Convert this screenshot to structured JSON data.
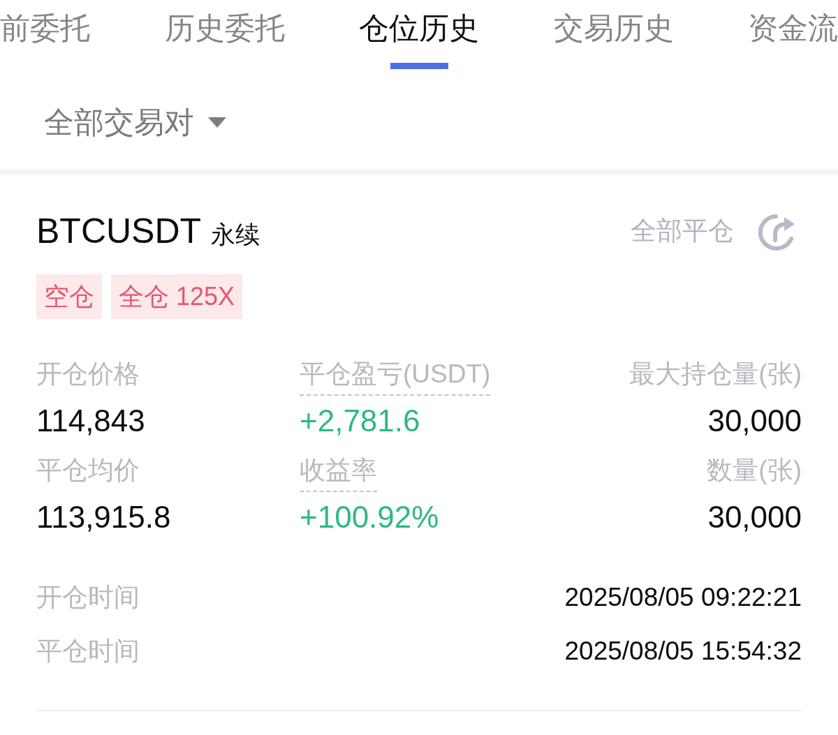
{
  "tabs": [
    {
      "label": "前委托",
      "selected": false
    },
    {
      "label": "历史委托",
      "selected": false
    },
    {
      "label": "仓位历史",
      "selected": true
    },
    {
      "label": "交易历史",
      "selected": false
    },
    {
      "label": "资金流",
      "selected": false
    }
  ],
  "filter": {
    "label": "全部交易对"
  },
  "position": {
    "symbol": "BTCUSDT",
    "contract_type": "永续",
    "close_all": "全部平仓",
    "tags": [
      {
        "label": "空仓"
      },
      {
        "label": "全仓 125X"
      }
    ],
    "stats": [
      {
        "label": "开仓价格",
        "value": "114,843",
        "kind": "plain"
      },
      {
        "label": "平仓盈亏(USDT)",
        "value": "+2,781.6",
        "kind": "pnl"
      },
      {
        "label": "最大持仓量(张)",
        "value": "30,000",
        "kind": "plain"
      },
      {
        "label": "平仓均价",
        "value": "113,915.8",
        "kind": "plain"
      },
      {
        "label": "收益率",
        "value": "+100.92%",
        "kind": "pnl"
      },
      {
        "label": "数量(张)",
        "value": "30,000",
        "kind": "plain"
      }
    ],
    "times": [
      {
        "label": "开仓时间",
        "value": "2025/08/05 09:22:21"
      },
      {
        "label": "平仓时间",
        "value": "2025/08/05 15:54:32"
      }
    ]
  }
}
